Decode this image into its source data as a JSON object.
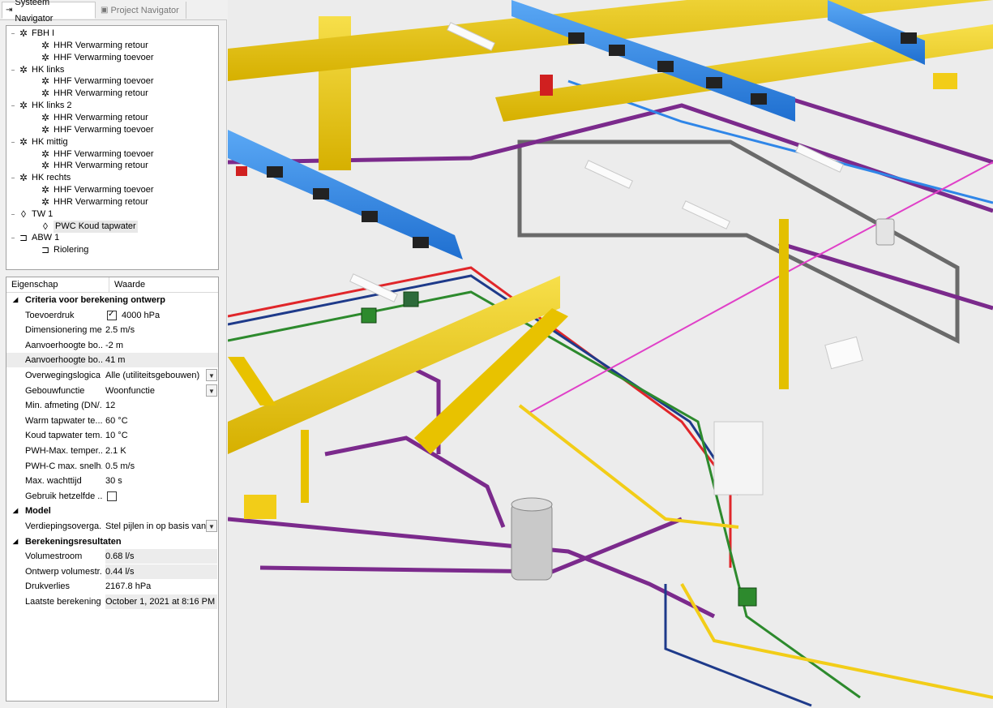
{
  "tabs": {
    "systeem": "Systeem Navigator",
    "project": "Project Navigator"
  },
  "tree": [
    {
      "label": "FBH I",
      "level": 0,
      "icon": "heating-snowflake-icon",
      "expanded": true
    },
    {
      "label": "HHR Verwarming retour",
      "level": 1,
      "icon": "heating-snowflake-icon"
    },
    {
      "label": "HHF Verwarming toevoer",
      "level": 1,
      "icon": "heating-snowflake-icon"
    },
    {
      "label": "HK links",
      "level": 0,
      "icon": "heating-snowflake-icon",
      "expanded": true
    },
    {
      "label": "HHF Verwarming toevoer",
      "level": 1,
      "icon": "heating-snowflake-icon"
    },
    {
      "label": "HHR Verwarming retour",
      "level": 1,
      "icon": "heating-snowflake-icon"
    },
    {
      "label": "HK links 2",
      "level": 0,
      "icon": "heating-snowflake-icon",
      "expanded": true
    },
    {
      "label": "HHR Verwarming retour",
      "level": 1,
      "icon": "heating-snowflake-icon"
    },
    {
      "label": "HHF Verwarming toevoer",
      "level": 1,
      "icon": "heating-snowflake-icon"
    },
    {
      "label": "HK mittig",
      "level": 0,
      "icon": "heating-snowflake-icon",
      "expanded": true
    },
    {
      "label": "HHF Verwarming toevoer",
      "level": 1,
      "icon": "heating-snowflake-icon"
    },
    {
      "label": "HHR Verwarming retour",
      "level": 1,
      "icon": "heating-snowflake-icon"
    },
    {
      "label": "HK rechts",
      "level": 0,
      "icon": "heating-snowflake-icon",
      "expanded": true
    },
    {
      "label": "HHF Verwarming toevoer",
      "level": 1,
      "icon": "heating-snowflake-icon"
    },
    {
      "label": "HHR Verwarming retour",
      "level": 1,
      "icon": "heating-snowflake-icon"
    },
    {
      "label": "TW 1",
      "level": 0,
      "icon": "water-drop-icon",
      "expanded": true
    },
    {
      "label": "PWC Koud tapwater",
      "level": 1,
      "icon": "water-drop-icon",
      "selected": true
    },
    {
      "label": "ABW 1",
      "level": 0,
      "icon": "drain-pipe-icon",
      "expanded": true
    },
    {
      "label": "Riolering",
      "level": 1,
      "icon": "drain-pipe-icon"
    }
  ],
  "props": {
    "col_name": "Eigenschap",
    "col_value": "Waarde",
    "groups": [
      {
        "title": "Criteria voor berekening ontwerp",
        "rows": [
          {
            "name": "Toevoerdruk",
            "value": "4000 hPa",
            "checkbox": true,
            "checked": true
          },
          {
            "name": "Dimensionering me...",
            "value": "2.5 m/s"
          },
          {
            "name": "Aanvoerhoogte bo...",
            "value": "-2 m"
          },
          {
            "name": "Aanvoerhoogte bo...",
            "value": "41 m",
            "highlight": true
          },
          {
            "name": "Overwegingslogica",
            "value": "Alle (utiliteitsgebouwen)",
            "dropdown": true
          },
          {
            "name": "Gebouwfunctie",
            "value": "Woonfunctie",
            "dropdown": true
          },
          {
            "name": "Min. afmeting (DN/...",
            "value": "12"
          },
          {
            "name": "Warm tapwater te...",
            "value": "60 °C"
          },
          {
            "name": "Koud tapwater tem...",
            "value": "10 °C"
          },
          {
            "name": "PWH-Max. temper...",
            "value": "2.1 K"
          },
          {
            "name": "PWH-C max. snelh...",
            "value": "0.5 m/s"
          },
          {
            "name": "Max. wachttijd",
            "value": "30 s"
          },
          {
            "name": "Gebruik hetzelfde ...",
            "value": "",
            "checkbox": true,
            "checked": false
          }
        ]
      },
      {
        "title": "Model",
        "rows": [
          {
            "name": "Verdiepingsoverga...",
            "value": "Stel pijlen in op basis van str",
            "dropdown": true
          }
        ]
      },
      {
        "title": "Berekeningsresultaten",
        "rows": [
          {
            "name": "Volumestroom",
            "value": "0.68 l/s",
            "valhl": true
          },
          {
            "name": "Ontwerp volumestr...",
            "value": "0.44 l/s",
            "valhl": true
          },
          {
            "name": "Drukverlies",
            "value": "2167.8 hPa"
          },
          {
            "name": "Laatste berekening",
            "value": "October 1, 2021 at 8:16 PM",
            "valhl": true
          }
        ]
      }
    ]
  },
  "colors": {
    "duct_yellow": "#f2cd18",
    "duct_blue": "#2f86e8",
    "pipe_purple": "#7b2a8c",
    "pipe_red": "#e0262a",
    "pipe_green": "#2d8a2d",
    "pipe_navy": "#1e3a8a",
    "pipe_magenta": "#e040c8",
    "tray_gray": "#6a6a6a"
  }
}
